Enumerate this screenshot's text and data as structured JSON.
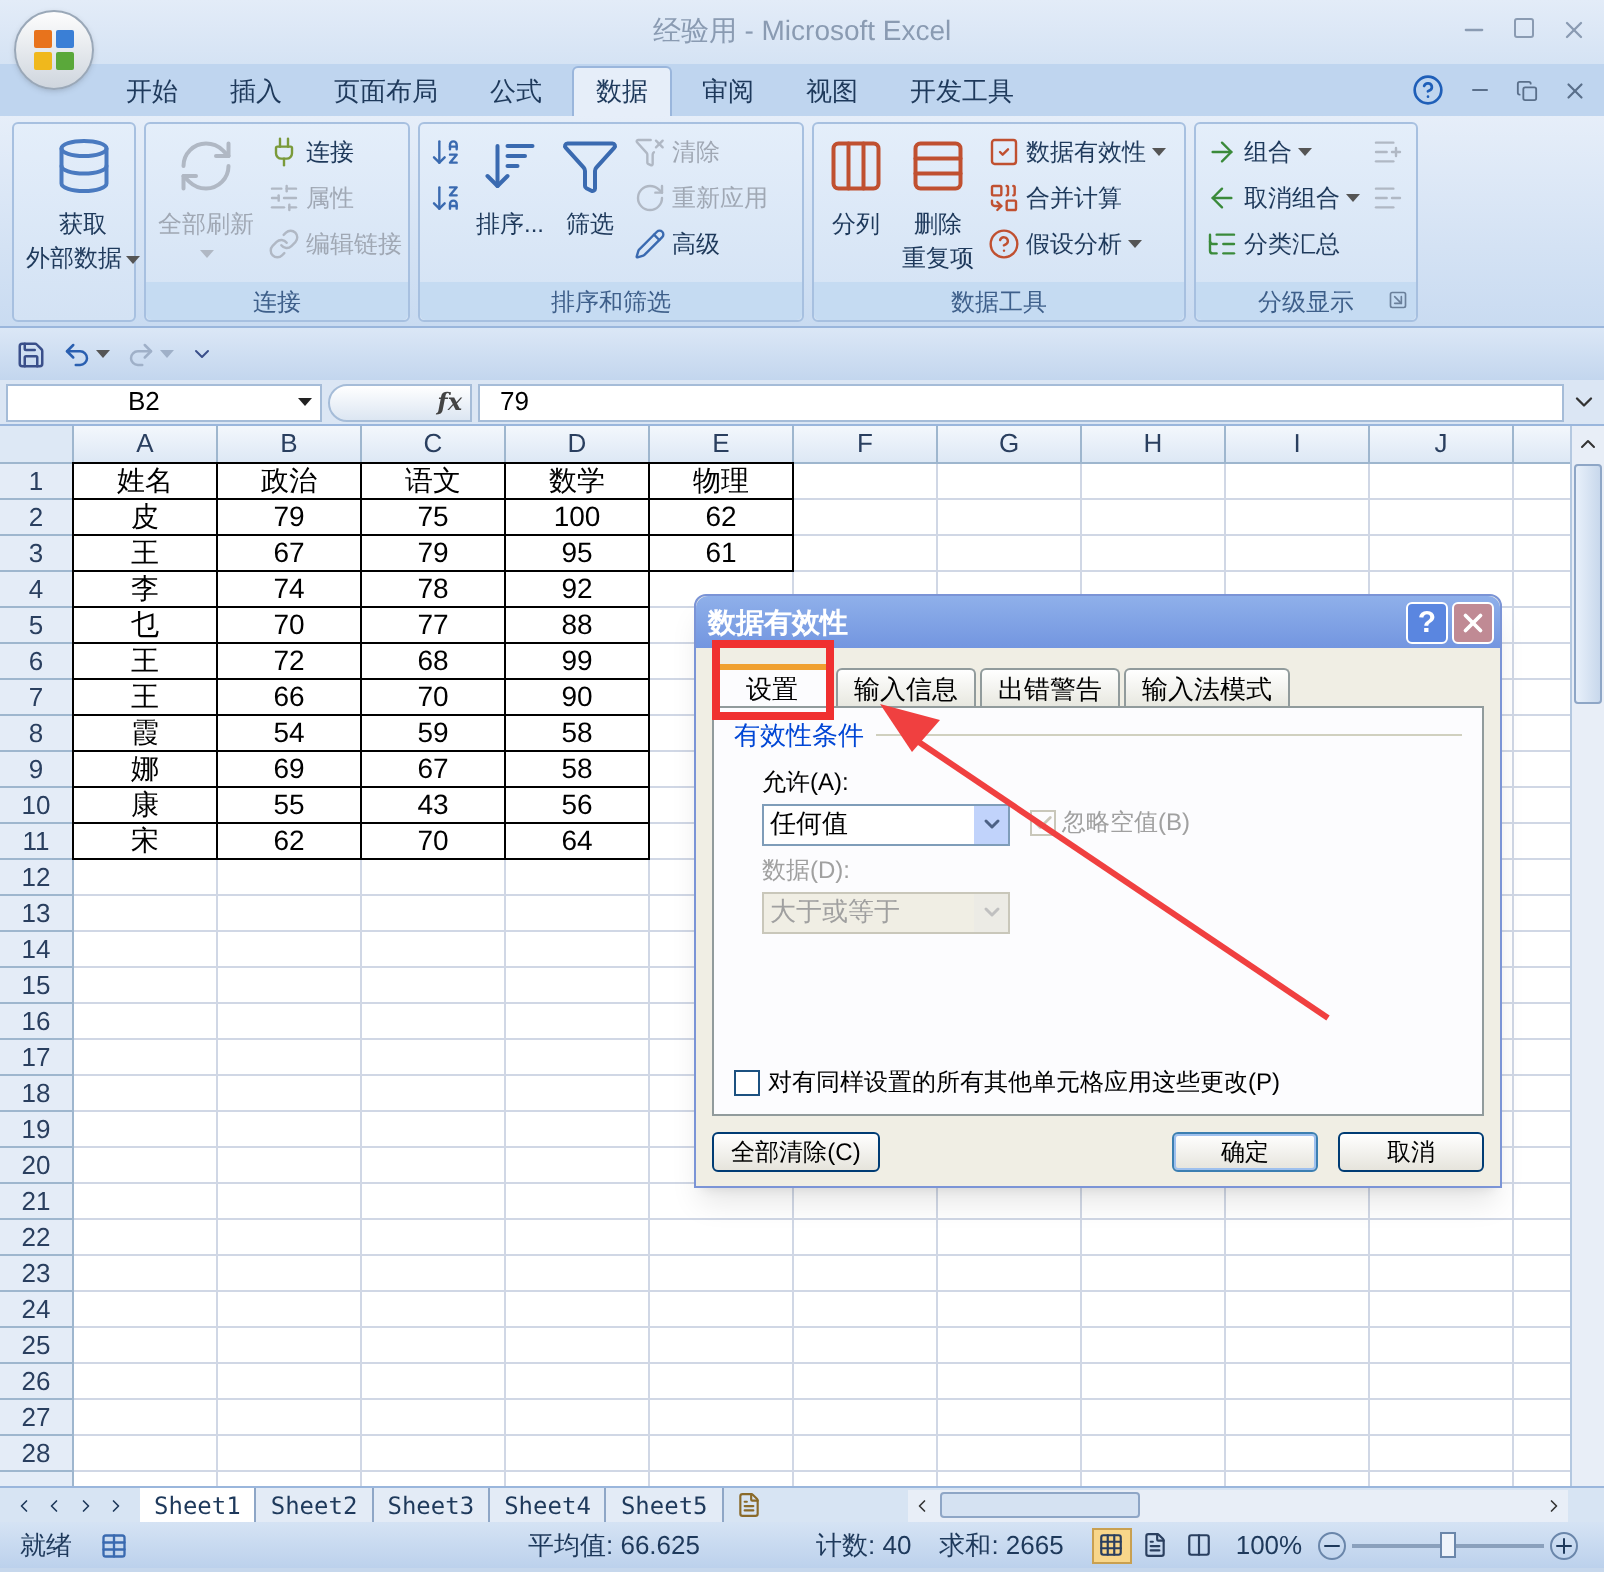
{
  "window": {
    "title": "经验用 - Microsoft Excel"
  },
  "ribbon_tabs": [
    {
      "label": "开始",
      "selected": false
    },
    {
      "label": "插入",
      "selected": false
    },
    {
      "label": "页面布局",
      "selected": false
    },
    {
      "label": "公式",
      "selected": false
    },
    {
      "label": "数据",
      "selected": true
    },
    {
      "label": "审阅",
      "selected": false
    },
    {
      "label": "视图",
      "selected": false
    },
    {
      "label": "开发工具",
      "selected": false
    }
  ],
  "ribbon_groups": [
    {
      "columns": [
        {
          "kind": "large",
          "label_lines": [
            "获取",
            "外部数据"
          ],
          "dropdown": true,
          "disabled": false
        }
      ]
    },
    {
      "title": "连接",
      "columns": [
        {
          "kind": "large",
          "label_lines": [
            "全部刷新"
          ],
          "dropdown": true,
          "disabled": true
        },
        {
          "kind": "stack",
          "buttons": [
            {
              "label": "连接",
              "disabled": false,
              "dropdown": false
            },
            {
              "label": "属性",
              "disabled": true,
              "dropdown": false
            },
            {
              "label": "编辑链接",
              "disabled": true,
              "dropdown": false
            }
          ]
        }
      ]
    },
    {
      "title": "排序和筛选",
      "columns": [
        {
          "kind": "stack",
          "buttons": [
            {
              "disabled": false,
              "dropdown": false
            },
            {
              "disabled": false,
              "dropdown": false
            }
          ]
        },
        {
          "kind": "large",
          "label_lines": [
            "排序..."
          ],
          "dropdown": false,
          "disabled": false
        },
        {
          "kind": "large",
          "label_lines": [
            "筛选"
          ],
          "dropdown": false,
          "disabled": false
        },
        {
          "kind": "stack",
          "buttons": [
            {
              "label": "清除",
              "disabled": true,
              "dropdown": false
            },
            {
              "label": "重新应用",
              "disabled": true,
              "dropdown": false
            },
            {
              "label": "高级",
              "disabled": false,
              "dropdown": false
            }
          ]
        }
      ]
    },
    {
      "title": "数据工具",
      "columns": [
        {
          "kind": "large",
          "label_lines": [
            "分列"
          ],
          "dropdown": false,
          "disabled": false
        },
        {
          "kind": "large",
          "label_lines": [
            "删除",
            "重复项"
          ],
          "dropdown": false,
          "disabled": false
        },
        {
          "kind": "stack",
          "buttons": [
            {
              "label": "数据有效性",
              "disabled": false,
              "dropdown": true
            },
            {
              "label": "合并计算",
              "disabled": false,
              "dropdown": false
            },
            {
              "label": "假设分析",
              "disabled": false,
              "dropdown": true
            }
          ]
        }
      ]
    },
    {
      "title": "分级显示",
      "launcher": true,
      "columns": [
        {
          "kind": "stack",
          "buttons": [
            {
              "label": "组合",
              "disabled": false,
              "dropdown": true
            },
            {
              "label": "取消组合",
              "disabled": false,
              "dropdown": true
            },
            {
              "label": "分类汇总",
              "disabled": false,
              "dropdown": false
            }
          ]
        },
        {
          "kind": "stack",
          "buttons": [
            {
              "disabled": true,
              "dropdown": false
            },
            {
              "disabled": true,
              "dropdown": false
            }
          ]
        }
      ]
    }
  ],
  "formula_bar": {
    "name_box": "B2",
    "function_label": "fx",
    "formula": "79"
  },
  "columns": [
    "A",
    "B",
    "C",
    "D",
    "E",
    "F",
    "G",
    "H",
    "I",
    "J"
  ],
  "rows": [
    {
      "number": "1",
      "cells": [
        "姓名",
        "政治",
        "语文",
        "数学",
        "物理"
      ]
    },
    {
      "number": "2",
      "cells": [
        "皮",
        "79",
        "75",
        "100",
        "62"
      ]
    },
    {
      "number": "3",
      "cells": [
        "王",
        "67",
        "79",
        "95",
        "61"
      ]
    },
    {
      "number": "4",
      "cells": [
        "李",
        "74",
        "78",
        "92"
      ]
    },
    {
      "number": "5",
      "cells": [
        "乜",
        "70",
        "77",
        "88"
      ]
    },
    {
      "number": "6",
      "cells": [
        "王",
        "72",
        "68",
        "99"
      ]
    },
    {
      "number": "7",
      "cells": [
        "王",
        "66",
        "70",
        "90"
      ]
    },
    {
      "number": "8",
      "cells": [
        "霞",
        "54",
        "59",
        "58"
      ]
    },
    {
      "number": "9",
      "cells": [
        "娜",
        "69",
        "67",
        "58"
      ]
    },
    {
      "number": "10",
      "cells": [
        "康",
        "55",
        "43",
        "56"
      ]
    },
    {
      "number": "11",
      "cells": [
        "宋",
        "62",
        "70",
        "64"
      ]
    },
    {
      "number": "12"
    },
    {
      "number": "13"
    },
    {
      "number": "14"
    },
    {
      "number": "15"
    },
    {
      "number": "16"
    },
    {
      "number": "17"
    },
    {
      "number": "18"
    },
    {
      "number": "19"
    },
    {
      "number": "20"
    },
    {
      "number": "21"
    },
    {
      "number": "22"
    },
    {
      "number": "23"
    },
    {
      "number": "24"
    },
    {
      "number": "25"
    },
    {
      "number": "26"
    },
    {
      "number": "27"
    },
    {
      "number": "28"
    }
  ],
  "sheet_tabs": [
    {
      "label": "Sheet1",
      "selected": true
    },
    {
      "label": "Sheet2",
      "selected": false
    },
    {
      "label": "Sheet3",
      "selected": false
    },
    {
      "label": "Sheet4",
      "selected": false
    },
    {
      "label": "Sheet5",
      "selected": false
    }
  ],
  "status_bar": {
    "ready": "就绪",
    "average": "平均值: 66.625",
    "count": "计数: 40",
    "sum": "求和: 2665",
    "view_buttons": [
      {
        "selected": true
      },
      {
        "selected": false
      },
      {
        "selected": false
      }
    ],
    "zoom": "100%",
    "zoom_level": {
      "level": 0.5
    }
  },
  "dialog": {
    "title": "数据有效性",
    "help": "?",
    "tabs": [
      {
        "label": "设置",
        "selected": true
      },
      {
        "label": "输入信息",
        "selected": false
      },
      {
        "label": "出错警告",
        "selected": false
      },
      {
        "label": "输入法模式",
        "selected": false
      }
    ],
    "section": "有效性条件",
    "allow": {
      "label": "允许(A):",
      "value": "任何值",
      "disabled": false
    },
    "ignore_blank": {
      "label": "忽略空值(B)",
      "checked": true,
      "disabled": true
    },
    "data": {
      "label": "数据(D):",
      "value": "大于或等于",
      "disabled": true
    },
    "apply_all": {
      "label": "对有同样设置的所有其他单元格应用这些更改(P)",
      "checked": false,
      "disabled": false
    },
    "buttons": [
      {
        "label": "全部清除(C)",
        "kind": "left"
      },
      {
        "label": "确定",
        "kind": "default"
      },
      {
        "label": "取消",
        "kind": "normal"
      }
    ]
  }
}
